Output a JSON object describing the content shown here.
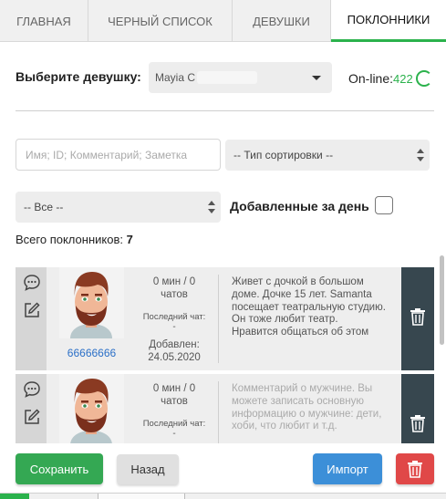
{
  "tabs": [
    {
      "label": "ГЛАВНАЯ"
    },
    {
      "label": "ЧЕРНЫЙ СПИСОК"
    },
    {
      "label": "ДЕВУШКИ"
    },
    {
      "label": "ПОКЛОННИКИ"
    }
  ],
  "active_tab": "ПОКЛОННИКИ",
  "girl_select": {
    "label": "Выберите девушку:",
    "value": "Mayia C"
  },
  "online": {
    "label": "On-line:",
    "count": "422"
  },
  "filters": {
    "search_placeholder": "Имя; ID; Комментарий; Заметка",
    "sort_value": "-- Тип сортировки --",
    "type_value": "-- Все --",
    "added_today_label": "Добавленные за день"
  },
  "total": {
    "label": "Всего поклонников:",
    "count": "7"
  },
  "fans": [
    {
      "id": "66666666",
      "time": "0 мин / 0",
      "chats": "чатов",
      "last_chat_label": "Последний чат:",
      "last_chat_value": "-",
      "added_label": "Добавлен:",
      "added_date": "24.05.2020",
      "comment": "Живет с дочкой в большом доме. Дочке 15 лет. Samanta посещает театральную студию. Он тоже любит театр. Нравится общаться об этом"
    },
    {
      "id": "",
      "time": "0 мин / 0",
      "chats": "чатов",
      "last_chat_label": "Последний чат:",
      "last_chat_value": "-",
      "comment_placeholder": "Комментарий о мужчине. Вы можете записать основную информацию о мужчине: дети, хоби, что любит и т.д."
    }
  ],
  "buttons": {
    "save": "Сохранить",
    "back": "Назад",
    "import": "Импорт"
  },
  "colors": {
    "accent_green": "#2bb24c",
    "save": "#34a853",
    "import": "#3c8fd8",
    "delete": "#e04848",
    "trash_column": "#37474f"
  },
  "icons": [
    "chat-icon",
    "edit-icon",
    "trash-icon",
    "spinner-icon",
    "caret-down-icon"
  ]
}
